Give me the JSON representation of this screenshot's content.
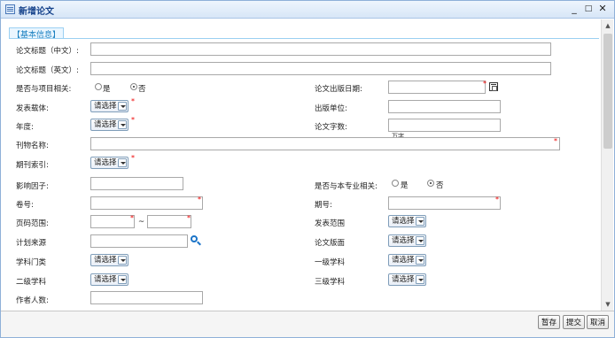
{
  "window": {
    "title": "新增论文",
    "minimize": "_",
    "maximize": "□",
    "close": "✕",
    "icons": {
      "title": "table-icon"
    }
  },
  "section": {
    "label": "【基本信息】"
  },
  "form": {
    "title_cn": {
      "label": "论文标题（中文）:",
      "value": ""
    },
    "title_en": {
      "label": "论文标题（英文）:",
      "value": ""
    },
    "project_related": {
      "label": "是否与项目相关:",
      "yes": "是",
      "no": "否",
      "selected": "no"
    },
    "pub_date": {
      "label": "论文出版日期:",
      "value": ""
    },
    "carrier": {
      "label": "发表载体:",
      "value": "请选择"
    },
    "publisher": {
      "label": "出版单位:",
      "value": ""
    },
    "year": {
      "label": "年度:",
      "value": "请选择"
    },
    "word_count": {
      "label": "论文字数:",
      "value": "",
      "unit": "万字"
    },
    "journal_name": {
      "label": "刊物名称:",
      "value": ""
    },
    "journal_index": {
      "label": "期刊索引:",
      "value": "请选择"
    },
    "impact_factor": {
      "label": "影响因子:",
      "value": ""
    },
    "major_related": {
      "label": "是否与本专业相关:",
      "yes": "是",
      "no": "否",
      "selected": "no"
    },
    "volume": {
      "label": "卷号:",
      "value": ""
    },
    "issue": {
      "label": "期号:",
      "value": ""
    },
    "page_range": {
      "label": "页码范围:",
      "from": "",
      "to": "",
      "sep": "~"
    },
    "pub_scope": {
      "label": "发表范围",
      "value": "请选择"
    },
    "plan_source": {
      "label": "计划来源",
      "value": ""
    },
    "layout": {
      "label": "论文版面",
      "value": "请选择"
    },
    "discipline_cat": {
      "label": "学科门类",
      "value": "请选择"
    },
    "level1": {
      "label": "一级学科",
      "value": "请选择"
    },
    "level2": {
      "label": "二级学科",
      "value": "请选择"
    },
    "level3": {
      "label": "三级学科",
      "value": "请选择"
    },
    "author_count": {
      "label": "作者人数:",
      "value": ""
    },
    "required_mark": "*"
  },
  "footer": {
    "save": "暂存",
    "submit": "提交",
    "cancel": "取消"
  },
  "colors": {
    "title": "#15428b",
    "section": "#1b80c0",
    "required": "#e00000"
  }
}
